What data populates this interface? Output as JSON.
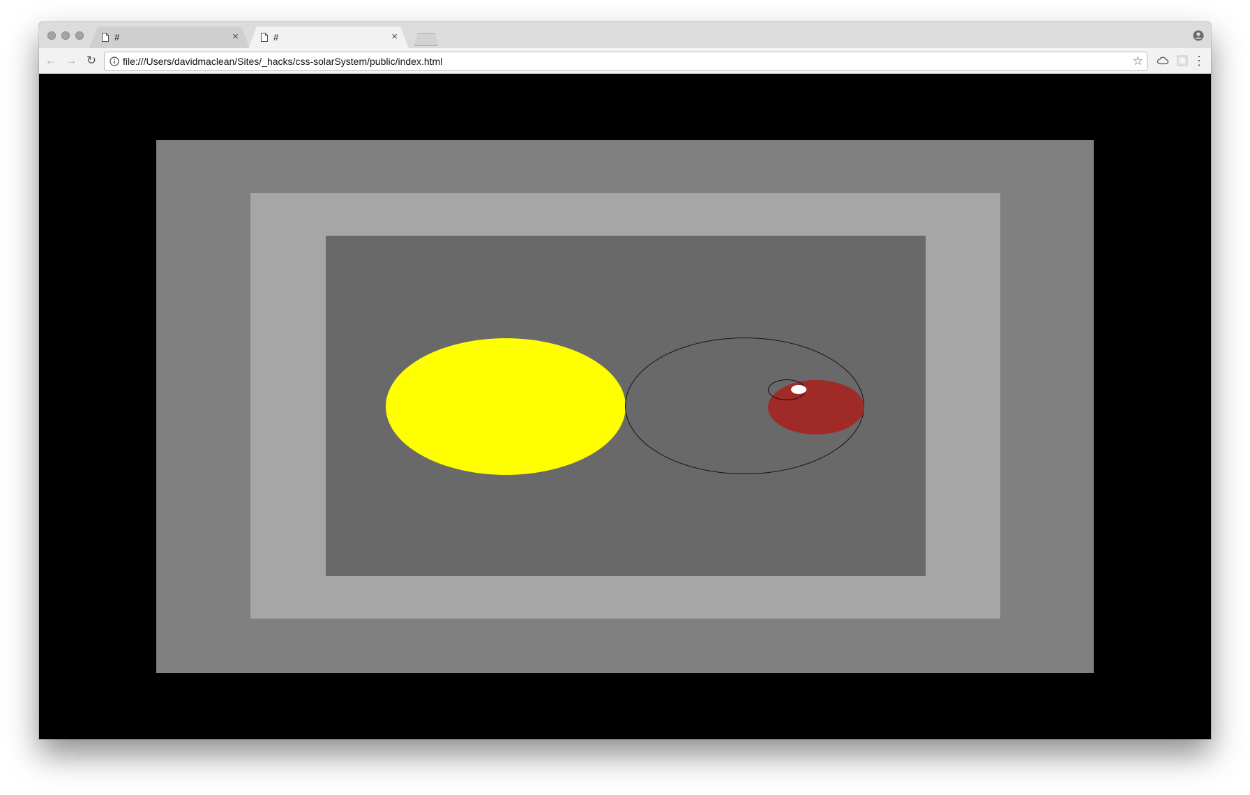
{
  "browser": {
    "tabs": [
      {
        "title": "#",
        "close": "×",
        "active": false
      },
      {
        "title": "#",
        "close": "×",
        "active": true
      }
    ],
    "nav": {
      "back": "←",
      "forward": "→",
      "reload": "↻"
    },
    "address_bar": {
      "url": "file:///Users/davidmaclean/Sites/_hacks/css-solarSystem/public/index.html",
      "bookmark_star": "☆"
    },
    "menu": "⋮"
  },
  "page": {
    "colors": {
      "background": "#000000",
      "frame_outer": "#808080",
      "frame_middle": "#a6a6a6",
      "frame_inner": "#696969",
      "sun": "#ffff00",
      "earth": "#a02a27",
      "moon": "#ffffff",
      "orbit_line": "#111111"
    },
    "bodies": [
      "sun",
      "earth-orbit",
      "earth",
      "moon-orbit",
      "moon"
    ]
  }
}
